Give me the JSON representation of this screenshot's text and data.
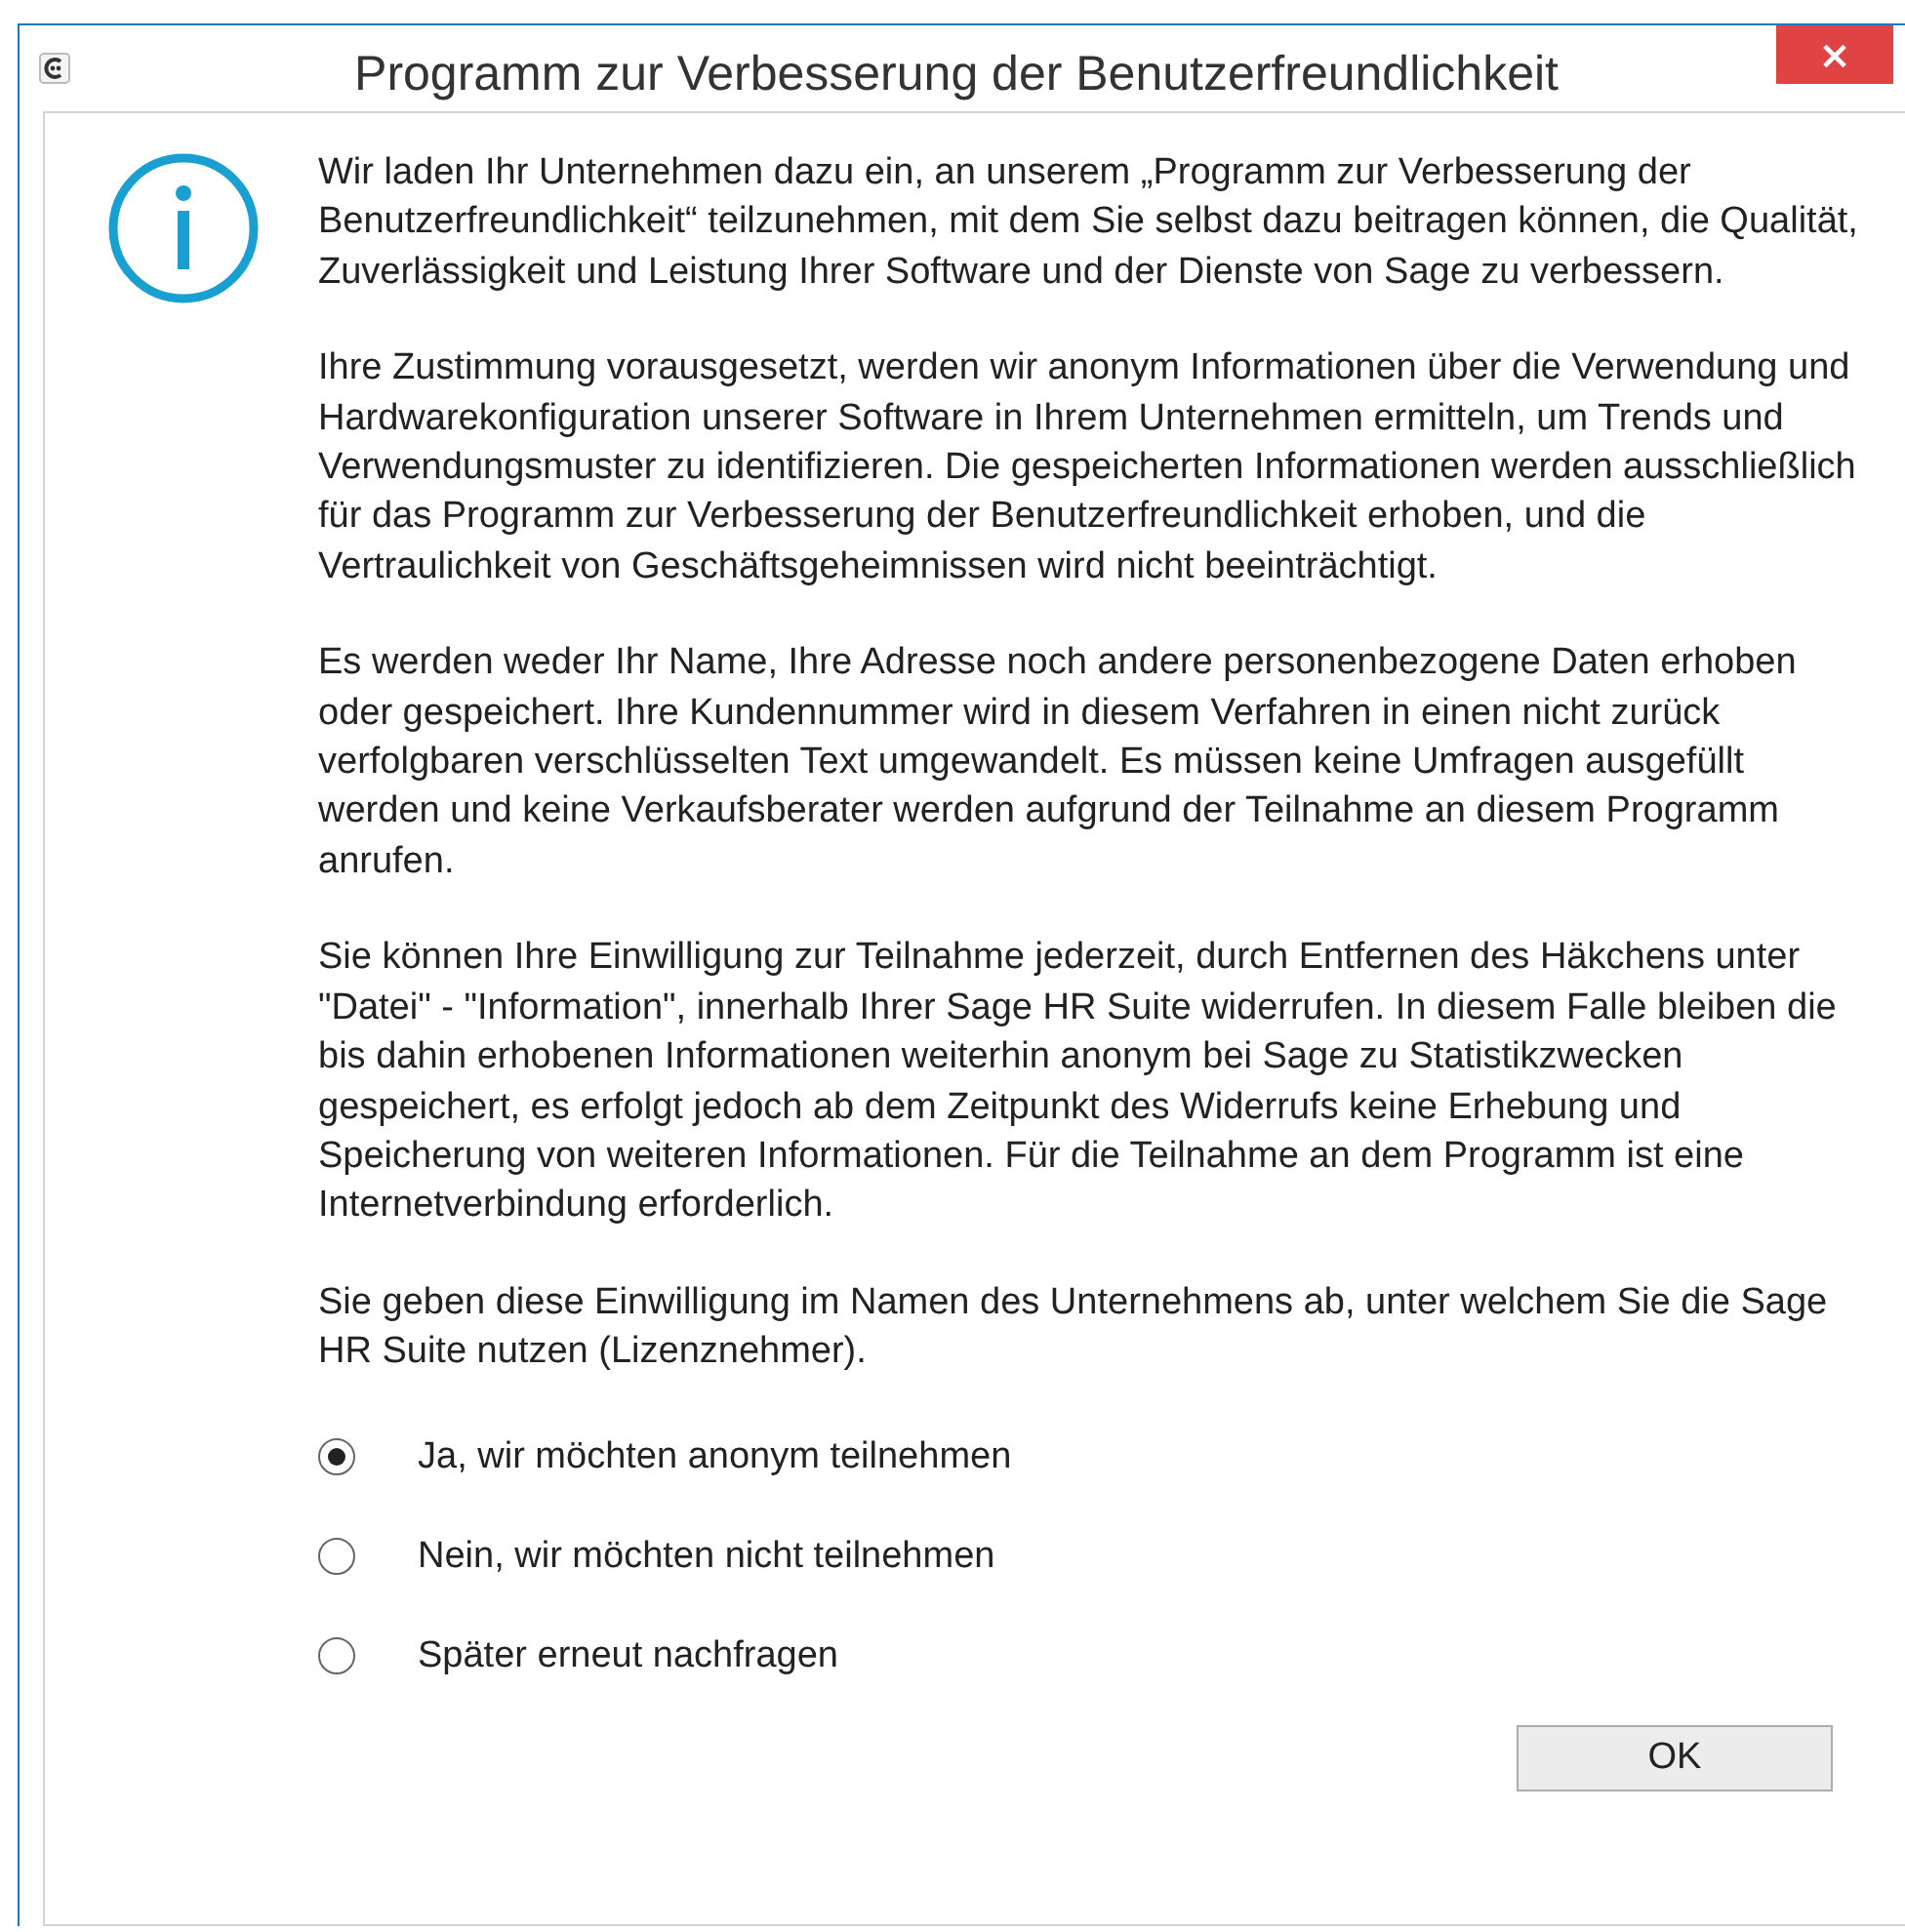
{
  "window": {
    "title": "Programm zur Verbesserung der Benutzerfreundlichkeit",
    "close": "×"
  },
  "paragraphs": [
    "Wir laden Ihr Unternehmen dazu ein, an unserem „Programm zur Verbesserung der Benutzerfreundlichkeit“ teilzunehmen, mit dem Sie selbst dazu beitragen können, die Qualität, Zuverlässigkeit und Leistung Ihrer Software und der Dienste von Sage zu verbessern.",
    "Ihre Zustimmung vorausgesetzt, werden wir anonym Informationen über die Verwendung und Hardwarekonfiguration unserer Software in Ihrem Unternehmen ermitteln, um Trends und Verwendungsmuster zu identifizieren. Die gespeicherten Informationen werden ausschließlich für das Programm zur Verbesserung der Benutzerfreundlichkeit erhoben, und die Vertraulichkeit von Geschäftsgeheimnissen wird nicht beeinträchtigt.",
    "Es werden weder Ihr Name, Ihre Adresse noch andere personenbezogene Daten erhoben oder gespeichert. Ihre Kundennummer wird in diesem Verfahren in einen nicht zurück verfolgbaren verschlüsselten Text umgewandelt. Es müssen keine Umfragen ausgefüllt werden und keine Verkaufsberater werden aufgrund der Teilnahme an diesem Programm anrufen.",
    "Sie können Ihre Einwilligung zur Teilnahme jederzeit, durch Entfernen des Häkchens unter \"Datei\" - \"Information\", innerhalb Ihrer Sage HR Suite widerrufen. In diesem Falle bleiben die bis dahin erhobenen Informationen weiterhin anonym bei Sage zu Statistikzwecken gespeichert, es erfolgt jedoch ab dem Zeitpunkt des Widerrufs keine Erhebung und Speicherung von weiteren Informationen. Für die Teilnahme an dem Programm ist eine Internetverbindung erforderlich.",
    "Sie geben diese Einwilligung im Namen des Unternehmens ab, unter welchem Sie die Sage HR Suite nutzen (Lizenznehmer)."
  ],
  "options": [
    {
      "label": "Ja, wir möchten anonym teilnehmen",
      "selected": true
    },
    {
      "label": "Nein, wir möchten nicht teilnehmen",
      "selected": false
    },
    {
      "label": "Später erneut nachfragen",
      "selected": false
    }
  ],
  "buttons": [
    "OK"
  ]
}
